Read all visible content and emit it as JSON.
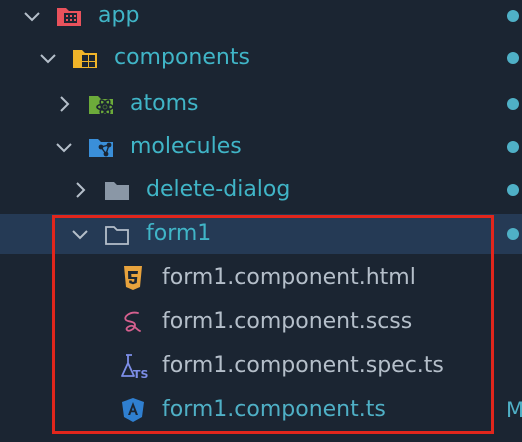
{
  "colors": {
    "background": "#1b2532",
    "selected_row": "#253a55",
    "folder_text": "#40b5c7",
    "file_text": "#b5bfca",
    "modified_text": "#4fb0c6",
    "highlight": "#e1261c",
    "dot": "#4fb0c6"
  },
  "tree": {
    "app": {
      "label": "app",
      "icon": "app-folder-icon",
      "expanded": true
    },
    "components": {
      "label": "components",
      "icon": "components-folder-icon",
      "expanded": true
    },
    "atoms": {
      "label": "atoms",
      "icon": "atoms-folder-icon",
      "expanded": false
    },
    "molecules": {
      "label": "molecules",
      "icon": "molecules-folder-icon",
      "expanded": true
    },
    "delete_dialog": {
      "label": "delete-dialog",
      "icon": "folder-icon",
      "expanded": false
    },
    "form1": {
      "label": "form1",
      "icon": "folder-open-icon",
      "expanded": true,
      "selected": true
    },
    "files": [
      {
        "label": "form1.component.html",
        "icon": "html5-icon"
      },
      {
        "label": "form1.component.scss",
        "icon": "sass-icon"
      },
      {
        "label": "form1.component.spec.ts",
        "icon": "test-ts-icon"
      },
      {
        "label": "form1.component.ts",
        "icon": "angular-icon",
        "status": "M"
      }
    ]
  }
}
